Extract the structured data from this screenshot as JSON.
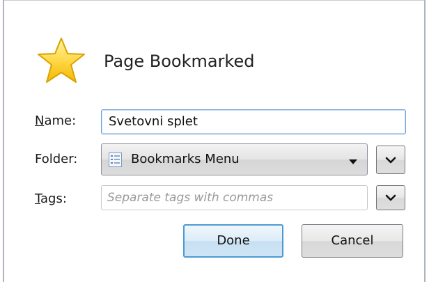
{
  "dialog": {
    "title": "Page Bookmarked",
    "icon": "star-icon"
  },
  "form": {
    "name": {
      "label_accel": "N",
      "label_rest": "ame:",
      "value": "Svetovni splet"
    },
    "folder": {
      "label": "Folder:",
      "selected": "Bookmarks Menu",
      "icon": "bookmarks-folder-icon"
    },
    "tags": {
      "label_accel": "T",
      "label_rest": "ags:",
      "value": "",
      "placeholder": "Separate tags with commas"
    }
  },
  "buttons": {
    "done": "Done",
    "cancel": "Cancel"
  },
  "colors": {
    "accent": "#4b9bd3",
    "star_fill": "#ffd94a",
    "star_outline": "#e0a800"
  }
}
